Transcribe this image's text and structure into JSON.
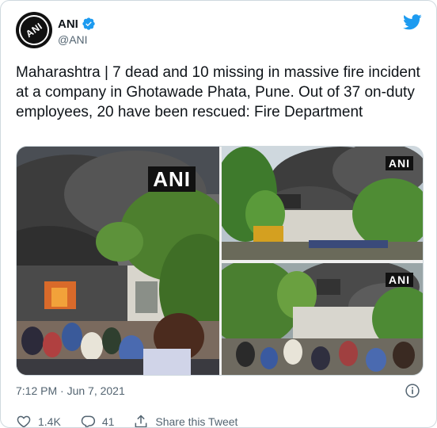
{
  "tweet": {
    "display_name": "ANI",
    "handle": "@ANI",
    "avatar_text": "ANI",
    "text": "Maharashtra | 7 dead and 10 missing in massive fire incident at a company in Ghotawade Phata, Pune. Out of 37 on-duty employees, 20 have been rescued: Fire Department",
    "timestamp": "7:12 PM · Jun 7, 2021",
    "likes": "1.4K",
    "replies": "41",
    "share_label": "Share this Tweet"
  },
  "media": {
    "photos": [
      {
        "watermark": "ANI"
      },
      {
        "watermark": "ANI"
      },
      {
        "watermark": "ANI"
      }
    ]
  },
  "icons": {
    "verified": "verified-badge-icon",
    "brand": "twitter-bird-icon",
    "info": "info-icon",
    "like": "heart-icon",
    "reply": "reply-bubble-icon",
    "share": "share-icon"
  },
  "colors": {
    "brand": "#1d9bf0",
    "text": "#0f1419",
    "muted": "#536471",
    "border": "#cfd9de"
  }
}
